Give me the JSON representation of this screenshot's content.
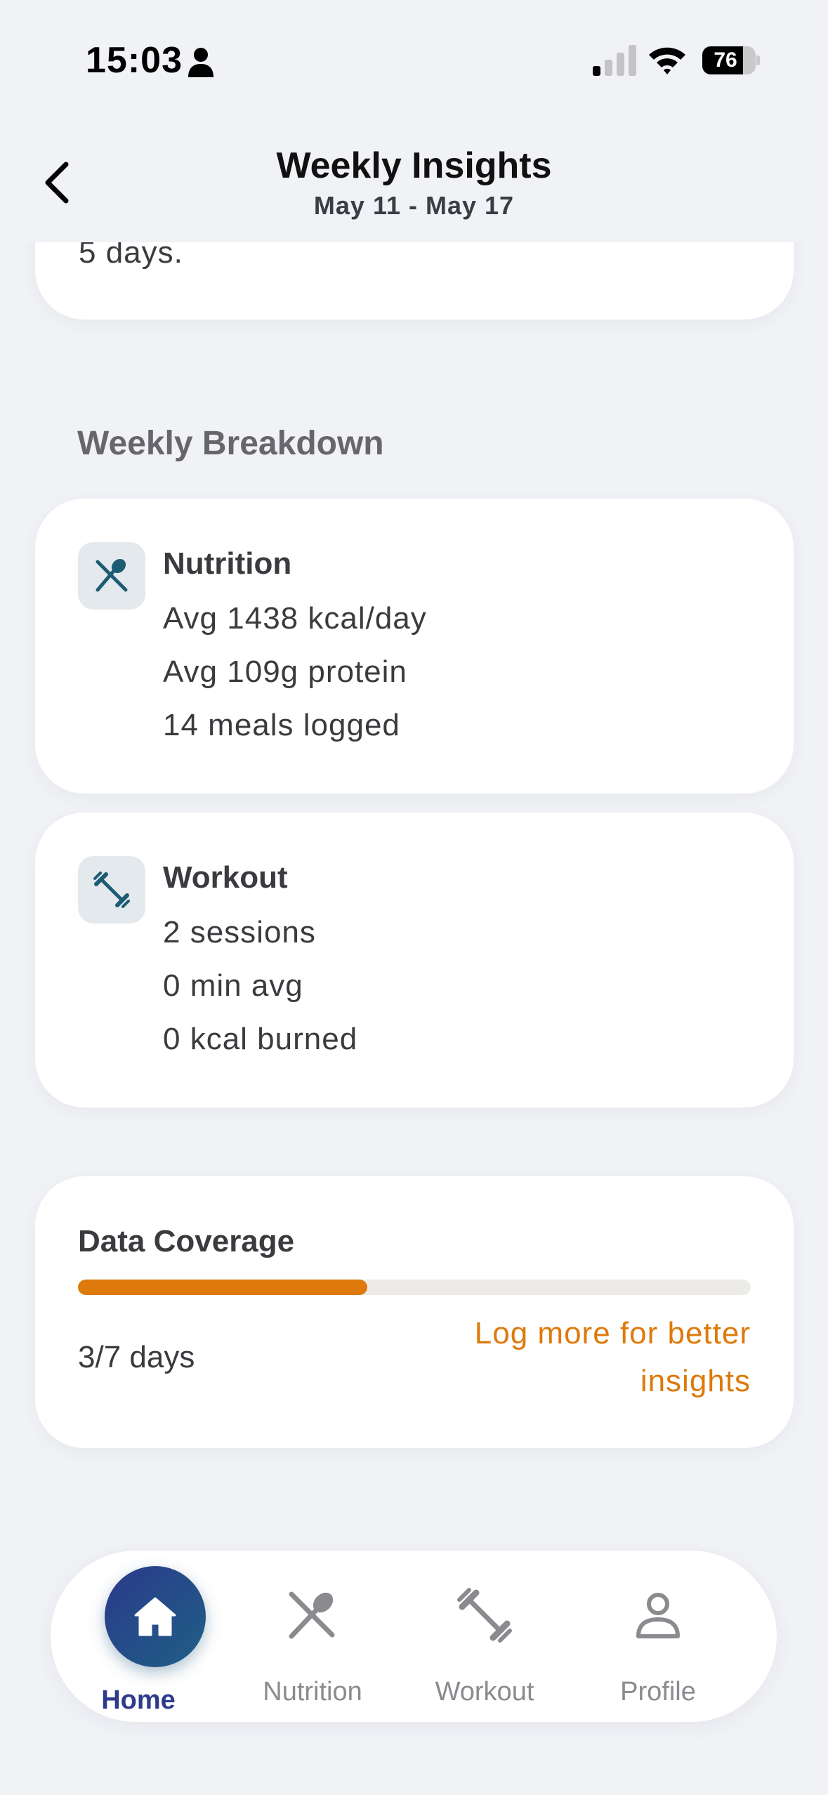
{
  "status_bar": {
    "time": "15:03",
    "battery": "76",
    "battery_percent": 76
  },
  "header": {
    "title": "Weekly Insights",
    "subtitle": "May 11 - May 17"
  },
  "summary": {
    "tail_text": "5 days."
  },
  "breakdown": {
    "title": "Weekly Breakdown",
    "nutrition": {
      "title": "Nutrition",
      "lines": [
        "Avg 1438 kcal/day",
        "Avg 109g protein",
        "14 meals logged"
      ],
      "icon": "fork-spoon-icon"
    },
    "workout": {
      "title": "Workout",
      "lines": [
        "2 sessions",
        "0 min avg",
        "0 kcal burned"
      ],
      "icon": "dumbbell-icon"
    }
  },
  "coverage": {
    "title": "Data Coverage",
    "days_text": "3/7 days",
    "fraction": 0.43,
    "hint": "Log more for better insights"
  },
  "tabs": [
    {
      "label": "Home",
      "icon": "home-icon",
      "active": true
    },
    {
      "label": "Nutrition",
      "icon": "fork-spoon-icon",
      "active": false
    },
    {
      "label": "Workout",
      "icon": "dumbbell-icon",
      "active": false
    },
    {
      "label": "Profile",
      "icon": "person-icon",
      "active": false
    }
  ],
  "colors": {
    "accent": "#dd7a0b",
    "active_tab": "#2e3a8c",
    "icon_teal": "#1d5d73",
    "inactive": "#8a8a8f",
    "background": "#f1f2f6"
  }
}
